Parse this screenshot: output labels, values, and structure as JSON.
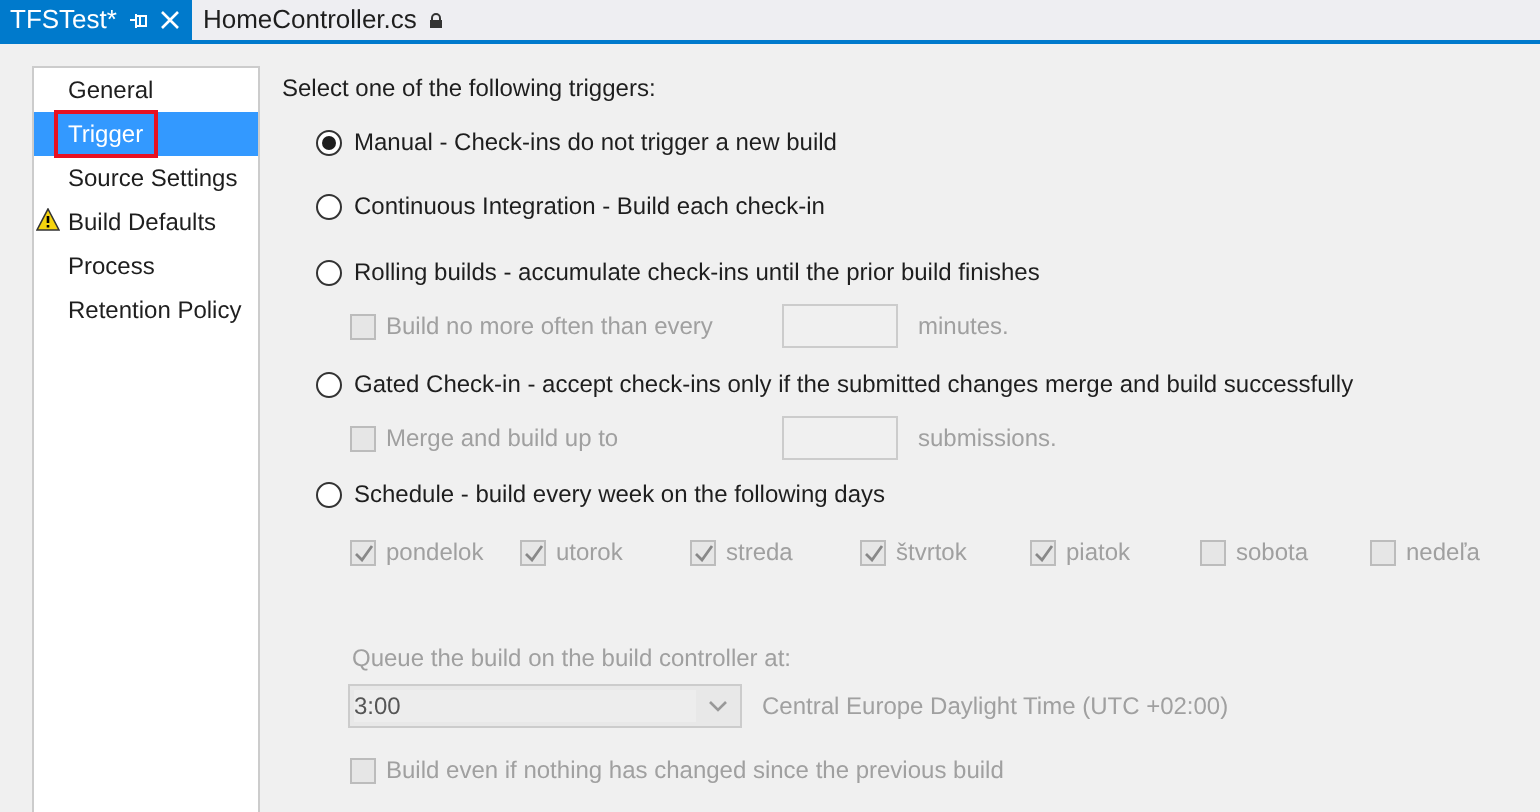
{
  "tabs": [
    {
      "label": "TFSTest*",
      "selected": true,
      "locked": false
    },
    {
      "label": "HomeController.cs",
      "selected": false,
      "locked": true
    }
  ],
  "sidebar": {
    "items": [
      {
        "label": "General",
        "selected": false,
        "highlighted": false,
        "warning": false
      },
      {
        "label": "Trigger",
        "selected": true,
        "highlighted": true,
        "warning": false
      },
      {
        "label": "Source Settings",
        "selected": false,
        "highlighted": false,
        "warning": false
      },
      {
        "label": "Build Defaults",
        "selected": false,
        "highlighted": false,
        "warning": true
      },
      {
        "label": "Process",
        "selected": false,
        "highlighted": false,
        "warning": false
      },
      {
        "label": "Retention Policy",
        "selected": false,
        "highlighted": false,
        "warning": false
      }
    ]
  },
  "triggers": {
    "heading": "Select one of the following triggers:",
    "options": [
      {
        "label": "Manual - Check-ins do not trigger a new build",
        "selected": true
      },
      {
        "label": "Continuous Integration - Build each check-in",
        "selected": false
      },
      {
        "label": "Rolling builds - accumulate check-ins until the prior build finishes",
        "selected": false,
        "sub": {
          "label": "Build no more often than every",
          "suffix": "minutes.",
          "checked": false,
          "disabled": true
        }
      },
      {
        "label": "Gated Check-in - accept check-ins only if the submitted changes merge and build successfully",
        "selected": false,
        "sub": {
          "label": "Merge and build up to",
          "suffix": "submissions.",
          "checked": false,
          "disabled": true
        }
      },
      {
        "label": "Schedule - build every week on the following days",
        "selected": false,
        "days": [
          {
            "label": "pondelok",
            "checked": true,
            "disabled": true
          },
          {
            "label": "utorok",
            "checked": true,
            "disabled": true
          },
          {
            "label": "streda",
            "checked": true,
            "disabled": true
          },
          {
            "label": "štvrtok",
            "checked": true,
            "disabled": true
          },
          {
            "label": "piatok",
            "checked": true,
            "disabled": true
          },
          {
            "label": "sobota",
            "checked": false,
            "disabled": true
          },
          {
            "label": "nedeľa",
            "checked": false,
            "disabled": true
          }
        ],
        "queue_label": "Queue the build on the build controller at:",
        "time": {
          "value": "3:00",
          "disabled": true
        },
        "timezone": "Central Europe Daylight Time (UTC +02:00)",
        "build_even": {
          "label": "Build even if nothing has changed since the previous build",
          "checked": false,
          "disabled": true
        }
      }
    ]
  }
}
